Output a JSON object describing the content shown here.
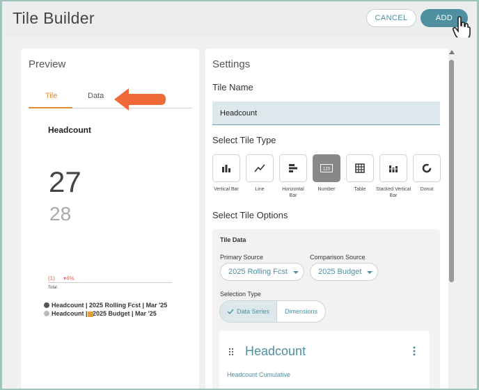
{
  "header": {
    "title": "Tile Builder",
    "cancel_label": "CANCEL",
    "add_label": "ADD"
  },
  "preview": {
    "title": "Preview",
    "tabs": [
      "Tile",
      "Data"
    ],
    "active_tab": "Tile",
    "tile_name": "Headcount",
    "primary_value": "27",
    "comparison_value": "28",
    "variance": "(1)",
    "variance_pct": "▾4%",
    "total_label": "Total",
    "legend": [
      {
        "text": "Headcount | 2025 Rolling Fcst | Mar '25",
        "color": "#555555"
      },
      {
        "text": "Headcount |   2025 Budget | Mar '25",
        "color": "#bbbbbb"
      }
    ]
  },
  "settings": {
    "title": "Settings",
    "tile_name_heading": "Tile Name",
    "tile_name_value": "Headcount",
    "tile_type_heading": "Select Tile Type",
    "tile_types": [
      {
        "label": "Vertical Bar",
        "icon": "vertical-bar-icon",
        "selected": false
      },
      {
        "label": "Line",
        "icon": "line-chart-icon",
        "selected": false
      },
      {
        "label": "Horizontal Bar",
        "icon": "horizontal-bar-icon",
        "selected": false
      },
      {
        "label": "Number",
        "icon": "number-icon",
        "selected": true
      },
      {
        "label": "Table",
        "icon": "table-icon",
        "selected": false
      },
      {
        "label": "Stacked Vertical Bar",
        "icon": "stacked-bar-icon",
        "selected": false
      },
      {
        "label": "Donut",
        "icon": "donut-icon",
        "selected": false
      }
    ],
    "tile_options_heading": "Select Tile Options",
    "tile_data": {
      "heading": "Tile Data",
      "primary_source_label": "Primary Source",
      "primary_source_value": "2025 Rolling Fcst",
      "comparison_source_label": "Comparison Source",
      "comparison_source_value": "2025 Budget",
      "selection_type_label": "Selection Type",
      "selection_options": [
        "Data Series",
        "Dimensions"
      ],
      "selected_option": "Data Series",
      "series_card": {
        "title": "Headcount",
        "subtitle": "Headcount Cumulative"
      }
    }
  },
  "colors": {
    "accent": "#4e8fa0",
    "tab_active": "#e08a2c",
    "arrow": "#ef6a36",
    "negative": "#e06a5a"
  }
}
